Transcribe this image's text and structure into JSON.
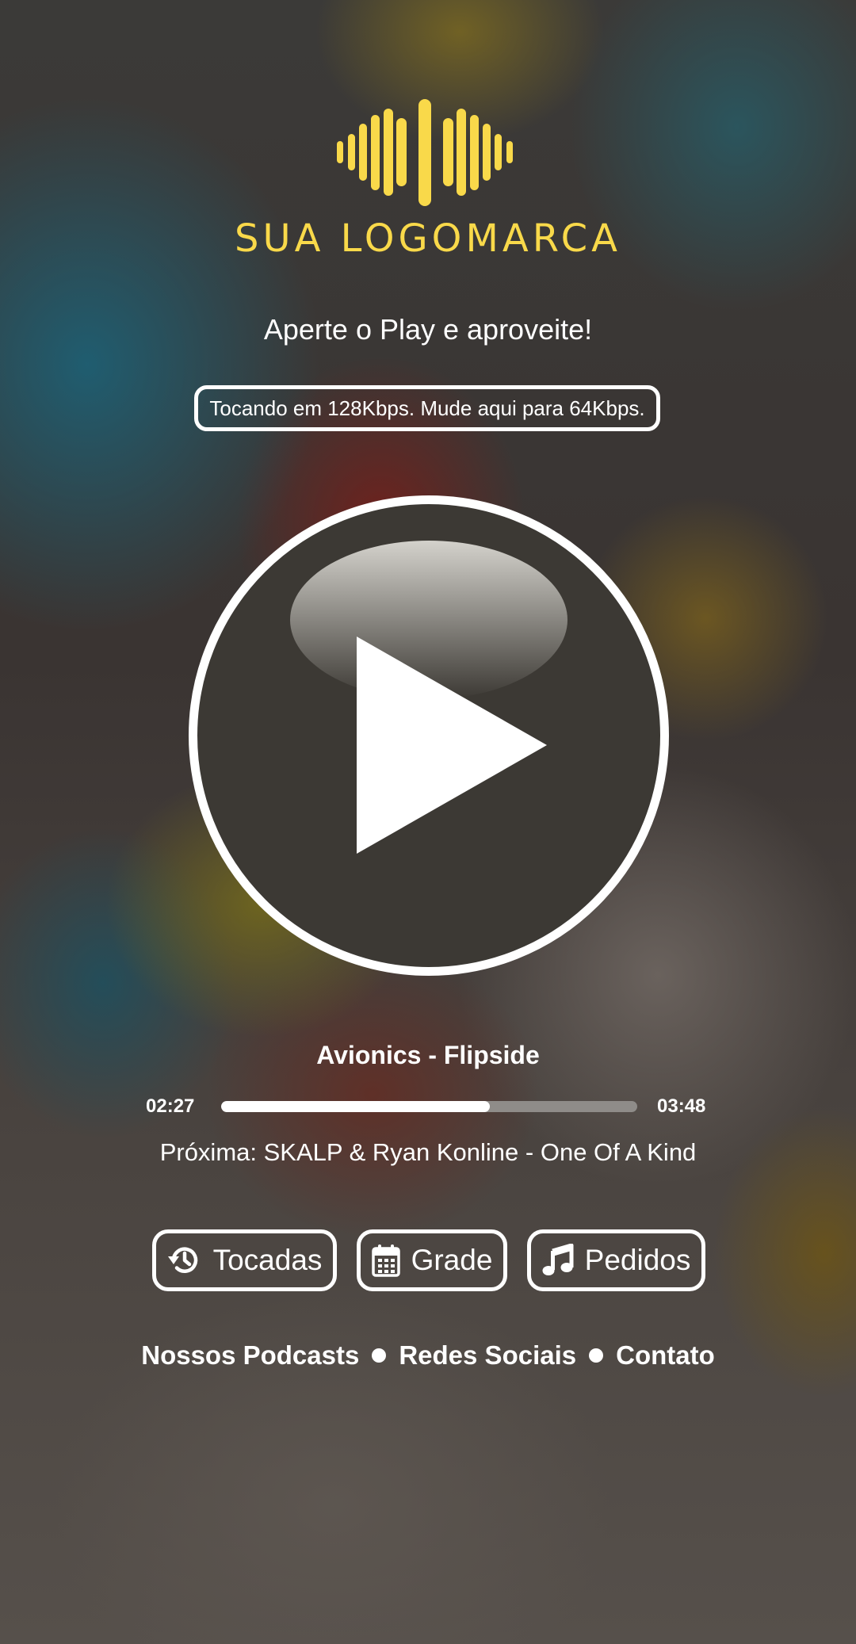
{
  "brand": {
    "logo_text": "SUA LOGOMARCA",
    "logo_color": "#f9d94a",
    "logo_icon": "sound-wave-icon"
  },
  "tagline": "Aperte o Play e aproveite!",
  "bitrate_toggle": {
    "label": "Tocando em 128Kbps. Mude aqui para 64Kbps."
  },
  "player": {
    "play_icon": "play-icon",
    "now_playing": "Avionics - Flipside",
    "elapsed": "02:27",
    "duration": "03:48",
    "progress_fraction": 0.645,
    "next": "Próxima: SKALP & Ryan Konline - One Of A Kind"
  },
  "actions": {
    "history": {
      "label": "Tocadas",
      "icon": "history-icon"
    },
    "schedule": {
      "label": "Grade",
      "icon": "calendar-icon"
    },
    "requests": {
      "label": "Pedidos",
      "icon": "music-note-icon"
    }
  },
  "footer": {
    "links": [
      "Nossos Podcasts",
      "Redes Sociais",
      "Contato"
    ]
  }
}
